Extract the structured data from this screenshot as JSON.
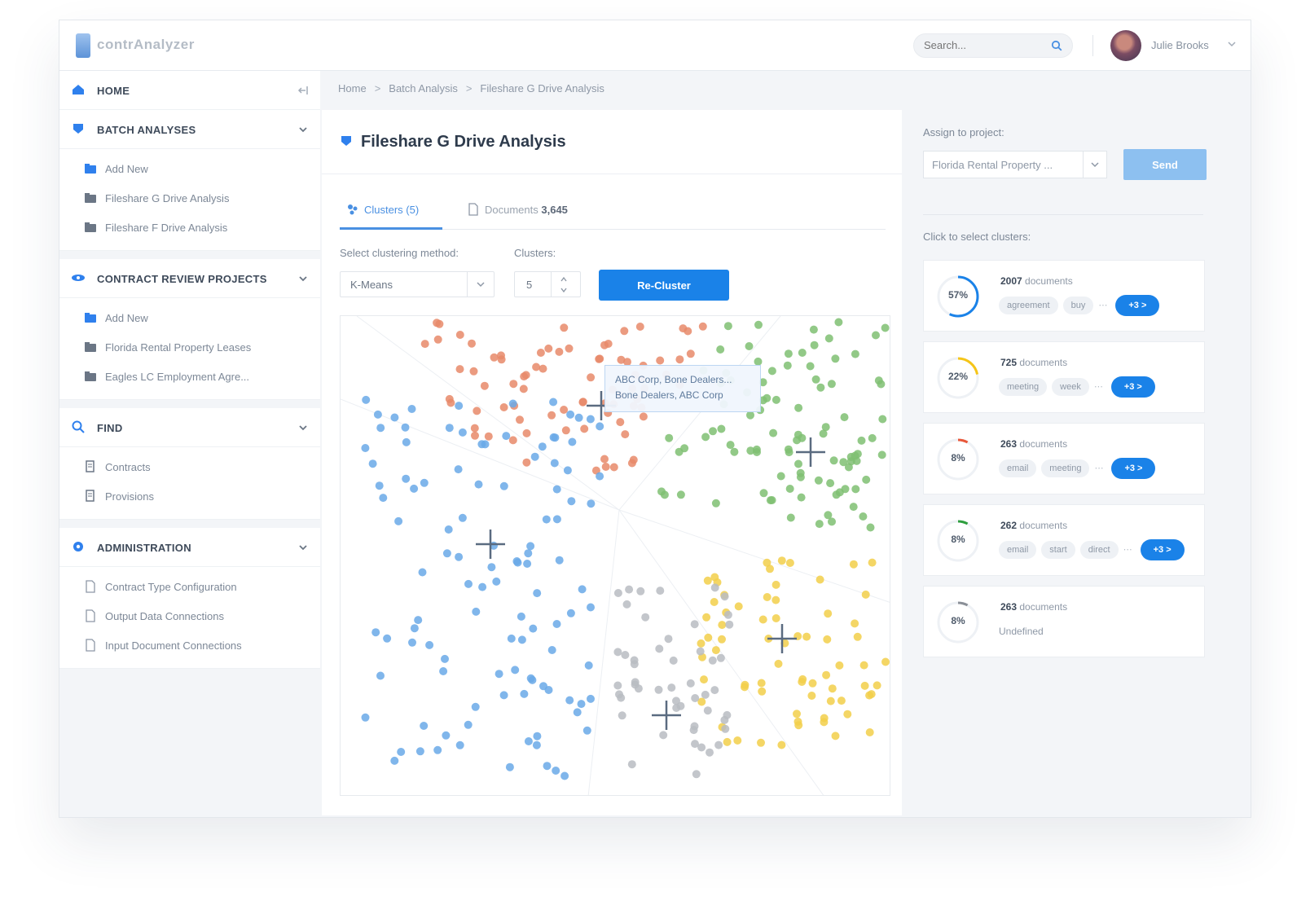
{
  "header": {
    "app_name": "contrAnalyzer",
    "search_placeholder": "Search...",
    "user_name": "Julie Brooks"
  },
  "sidebar": {
    "home": "HOME",
    "batch_analysis": {
      "title": "BATCH ANALYSES",
      "items": [
        {
          "label": "Add New"
        },
        {
          "label": "Fileshare G Drive Analysis"
        },
        {
          "label": "Fileshare F Drive Analysis"
        }
      ]
    },
    "contract_review": {
      "title": "CONTRACT REVIEW PROJECTS",
      "items": [
        {
          "label": "Add New"
        },
        {
          "label": "Florida Rental Property Leases"
        },
        {
          "label": "Eagles LC Employment Agre..."
        }
      ]
    },
    "find": {
      "title": "FIND",
      "items": [
        {
          "label": "Contracts"
        },
        {
          "label": "Provisions"
        }
      ]
    },
    "administration": {
      "title": "ADMINISTRATION",
      "items": [
        {
          "label": "Contract Type Configuration"
        },
        {
          "label": "Output Data Connections"
        },
        {
          "label": "Input Document Connections"
        }
      ]
    }
  },
  "breadcrumb": [
    "Home",
    "Batch Analysis",
    "Fileshare G Drive Analysis"
  ],
  "breadcrumb_sep": ">",
  "main": {
    "title": "Fileshare G Drive Analysis",
    "tabs": {
      "clusters": "Clusters (5)",
      "documents_label": "Documents",
      "documents_count": "3,645"
    },
    "method_label": "Select clustering method:",
    "method_value": "K-Means",
    "clusters_label": "Clusters:",
    "clusters_value": "5",
    "recluster_label": "Re-Cluster",
    "tooltip": [
      "ABC Corp, Bone Dealers...",
      "Bone Dealers, ABC Corp"
    ]
  },
  "right": {
    "assign_label": "Assign to project:",
    "project_value": "Florida Rental Property ...",
    "send_label": "Send",
    "clusters_hint": "Click to select clusters:",
    "cards": [
      {
        "pct": "57%",
        "pct_value": 57,
        "count": "2007",
        "suffix": "documents",
        "tags": [
          "agreement",
          "buy"
        ],
        "more": "+3 >",
        "color": "#1a82e8"
      },
      {
        "pct": "22%",
        "pct_value": 22,
        "count": "725",
        "suffix": "documents",
        "tags": [
          "meeting",
          "week"
        ],
        "more": "+3 >",
        "color": "#f5c518"
      },
      {
        "pct": "8%",
        "pct_value": 8,
        "count": "263",
        "suffix": "documents",
        "tags": [
          "email",
          "meeting"
        ],
        "more": "+3 >",
        "color": "#e8583a"
      },
      {
        "pct": "8%",
        "pct_value": 8,
        "count": "262",
        "suffix": "documents",
        "tags": [
          "email",
          "start",
          "direct"
        ],
        "more": "+3 >",
        "color": "#2e9e3e"
      },
      {
        "pct": "8%",
        "pct_value": 8,
        "count": "263",
        "suffix": "documents",
        "undefined": "Undefined",
        "color": "#8a8f97"
      }
    ]
  },
  "chart_data": {
    "type": "scatter",
    "title": "",
    "xlabel": "",
    "ylabel": "",
    "grid": false,
    "legend": "none",
    "clusters": [
      {
        "color": "#e8896a",
        "count": 2007
      },
      {
        "color": "#6aa9e8",
        "count": 725
      },
      {
        "color": "#7fbf72",
        "count": 263
      },
      {
        "color": "#f2cf4a",
        "count": 262
      },
      {
        "color": "#b8bcc2",
        "count": 263
      }
    ]
  }
}
